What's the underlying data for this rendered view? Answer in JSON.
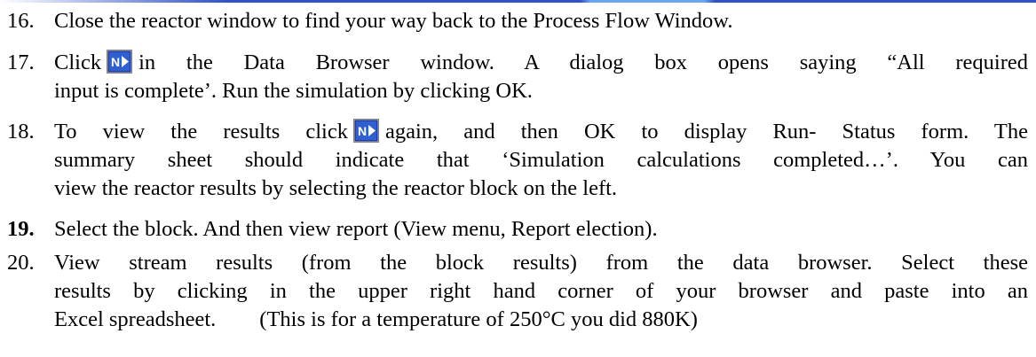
{
  "icons": {
    "next_button": "next-arrow-icon",
    "colors": {
      "background": "#2f5fd0",
      "text": "#ffffff",
      "border": "#0b1f7a"
    }
  },
  "steps": [
    {
      "number": "16.",
      "lines": [
        "Close the reactor window to find your way back to the Process Flow Window."
      ]
    },
    {
      "number": "17.",
      "line1_before": "Click",
      "line1_after": "in the Data Browser window. A dialog box opens saying “All required",
      "line2": "input is complete’. Run the simulation by clicking OK."
    },
    {
      "number": "18.",
      "line1_before": "To view the results click",
      "line1_after": "again, and then OK to display Run- Status form.  The",
      "line2": "summary sheet should indicate that ‘Simulation calculations completed…’.  You can",
      "line3": "view the reactor results by selecting the reactor block on the left."
    },
    {
      "number": "19.",
      "lines": [
        "Select the block.  And then view report (View menu, Report election)."
      ]
    },
    {
      "number": "20.",
      "lines": [
        "View stream results (from the block results) from the data browser.  Select these",
        "results by clicking in the upper right hand corner of your browser and paste into an",
        "Excel spreadsheet.        (This is for a temperature of 250°C you did 880K)"
      ]
    }
  ]
}
